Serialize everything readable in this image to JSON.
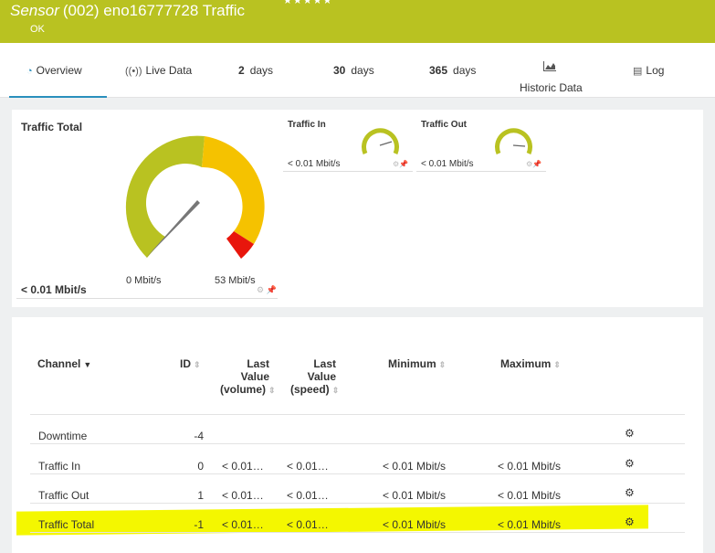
{
  "header": {
    "sensor_word": "Sensor",
    "title": "(002) eno16777728 Traffic",
    "stars": "★★★★★",
    "status": "OK"
  },
  "tabs": {
    "overview": "Overview",
    "live": "Live Data",
    "d2_num": "2",
    "d2_unit": "days",
    "d30_num": "30",
    "d30_unit": "days",
    "d365_num": "365",
    "d365_unit": "days",
    "historic": "Historic Data",
    "log": "Log"
  },
  "gauges": {
    "main": {
      "title": "Traffic Total",
      "min_label": "0 Mbit/s",
      "max_label": "53 Mbit/s",
      "value": "< 0.01 Mbit/s"
    },
    "traffic_in": {
      "title": "Traffic In",
      "value": "< 0.01 Mbit/s"
    },
    "traffic_out": {
      "title": "Traffic Out",
      "value": "< 0.01 Mbit/s"
    },
    "colors": {
      "green": "#b9c221",
      "yellow": "#f5c200",
      "red": "#e8160c"
    }
  },
  "table": {
    "headers": {
      "channel": "Channel",
      "id": "ID",
      "last_volume_1": "Last",
      "last_volume_2": "Value",
      "last_volume_3": "(volume)",
      "last_speed_1": "Last",
      "last_speed_2": "Value",
      "last_speed_3": "(speed)",
      "minimum": "Minimum",
      "maximum": "Maximum"
    },
    "rows": [
      {
        "channel": "Downtime",
        "id": "-4",
        "last_volume": "",
        "last_speed": "",
        "minimum": "",
        "maximum": ""
      },
      {
        "channel": "Traffic In",
        "id": "0",
        "last_volume": "< 0.01…",
        "last_speed": "< 0.01…",
        "minimum": "< 0.01 Mbit/s",
        "maximum": "< 0.01 Mbit/s"
      },
      {
        "channel": "Traffic Out",
        "id": "1",
        "last_volume": "< 0.01…",
        "last_speed": "< 0.01…",
        "minimum": "< 0.01 Mbit/s",
        "maximum": "< 0.01 Mbit/s"
      },
      {
        "channel": "Traffic Total",
        "id": "-1",
        "last_volume": "< 0.01…",
        "last_speed": "< 0.01…",
        "minimum": "< 0.01 Mbit/s",
        "maximum": "< 0.01 Mbit/s"
      }
    ],
    "highlight_color": "#f4f700"
  }
}
